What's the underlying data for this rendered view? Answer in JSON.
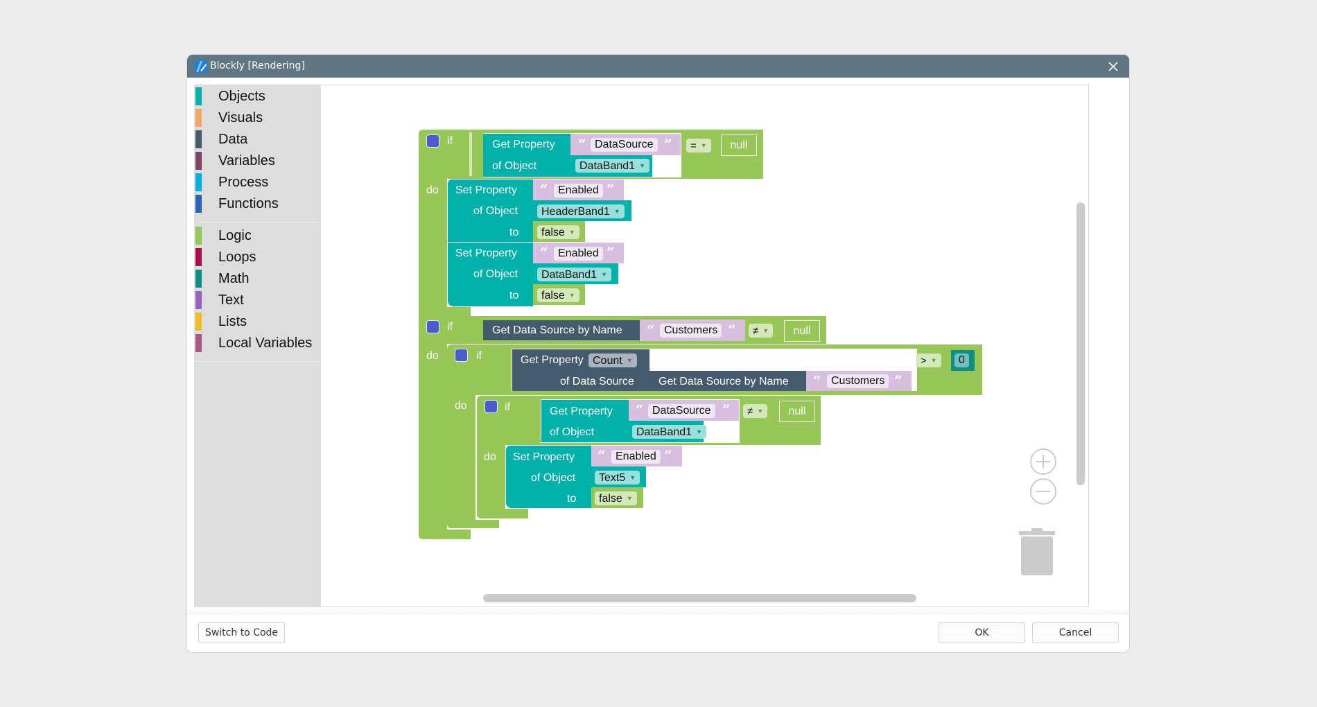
{
  "window": {
    "title": "Blockly [Rendering]",
    "close_icon": "close-icon",
    "app_icon": "blockly-app-icon"
  },
  "toolbox": {
    "groups": [
      [
        {
          "label": "Objects",
          "color": "#00b2a9"
        },
        {
          "label": "Visuals",
          "color": "#f3a75e"
        },
        {
          "label": "Data",
          "color": "#445b6d"
        },
        {
          "label": "Variables",
          "color": "#7d4563"
        },
        {
          "label": "Process",
          "color": "#00b1e2"
        },
        {
          "label": "Functions",
          "color": "#2766b2"
        }
      ],
      [
        {
          "label": "Logic",
          "color": "#97c857"
        },
        {
          "label": "Loops",
          "color": "#ab0e4b"
        },
        {
          "label": "Math",
          "color": "#0f8e86"
        },
        {
          "label": "Text",
          "color": "#9562be"
        },
        {
          "label": "Lists",
          "color": "#ecbf1f"
        },
        {
          "label": "Local Variables",
          "color": "#a55b80"
        }
      ]
    ]
  },
  "side_buttons": {
    "open": "open-folder-icon",
    "save": "save-icon"
  },
  "zoom_controls": {
    "zoom_in": "zoom-in-icon",
    "zoom_out": "zoom-out-icon",
    "trash": "trash-icon"
  },
  "blocks": {
    "kw_if": "if",
    "kw_do": "do",
    "kw_to": "to",
    "get_property": "Get Property",
    "set_property": "Set Property",
    "of_object": "of Object",
    "of_data_source": "of Data Source",
    "get_ds_by_name": "Get Data Source by Name",
    "null": "null",
    "if1": {
      "prop": "DataSource",
      "object": "DataBand1",
      "op": "=",
      "do": [
        {
          "prop": "Enabled",
          "object": "HeaderBand1",
          "value": "false"
        },
        {
          "prop": "Enabled",
          "object": "DataBand1",
          "value": "false"
        }
      ]
    },
    "if2": {
      "ds_name": "Customers",
      "op": "≠",
      "inner_if": {
        "prop": "Count",
        "ds_name": "Customers",
        "op": ">",
        "number": "0",
        "inner_if": {
          "prop": "DataSource",
          "object": "DataBand1",
          "op": "≠",
          "do": [
            {
              "prop": "Enabled",
              "object": "Text5",
              "value": "false"
            }
          ]
        }
      }
    }
  },
  "footer": {
    "switch_label": "Switch to Code",
    "ok_label": "OK",
    "cancel_label": "Cancel"
  }
}
